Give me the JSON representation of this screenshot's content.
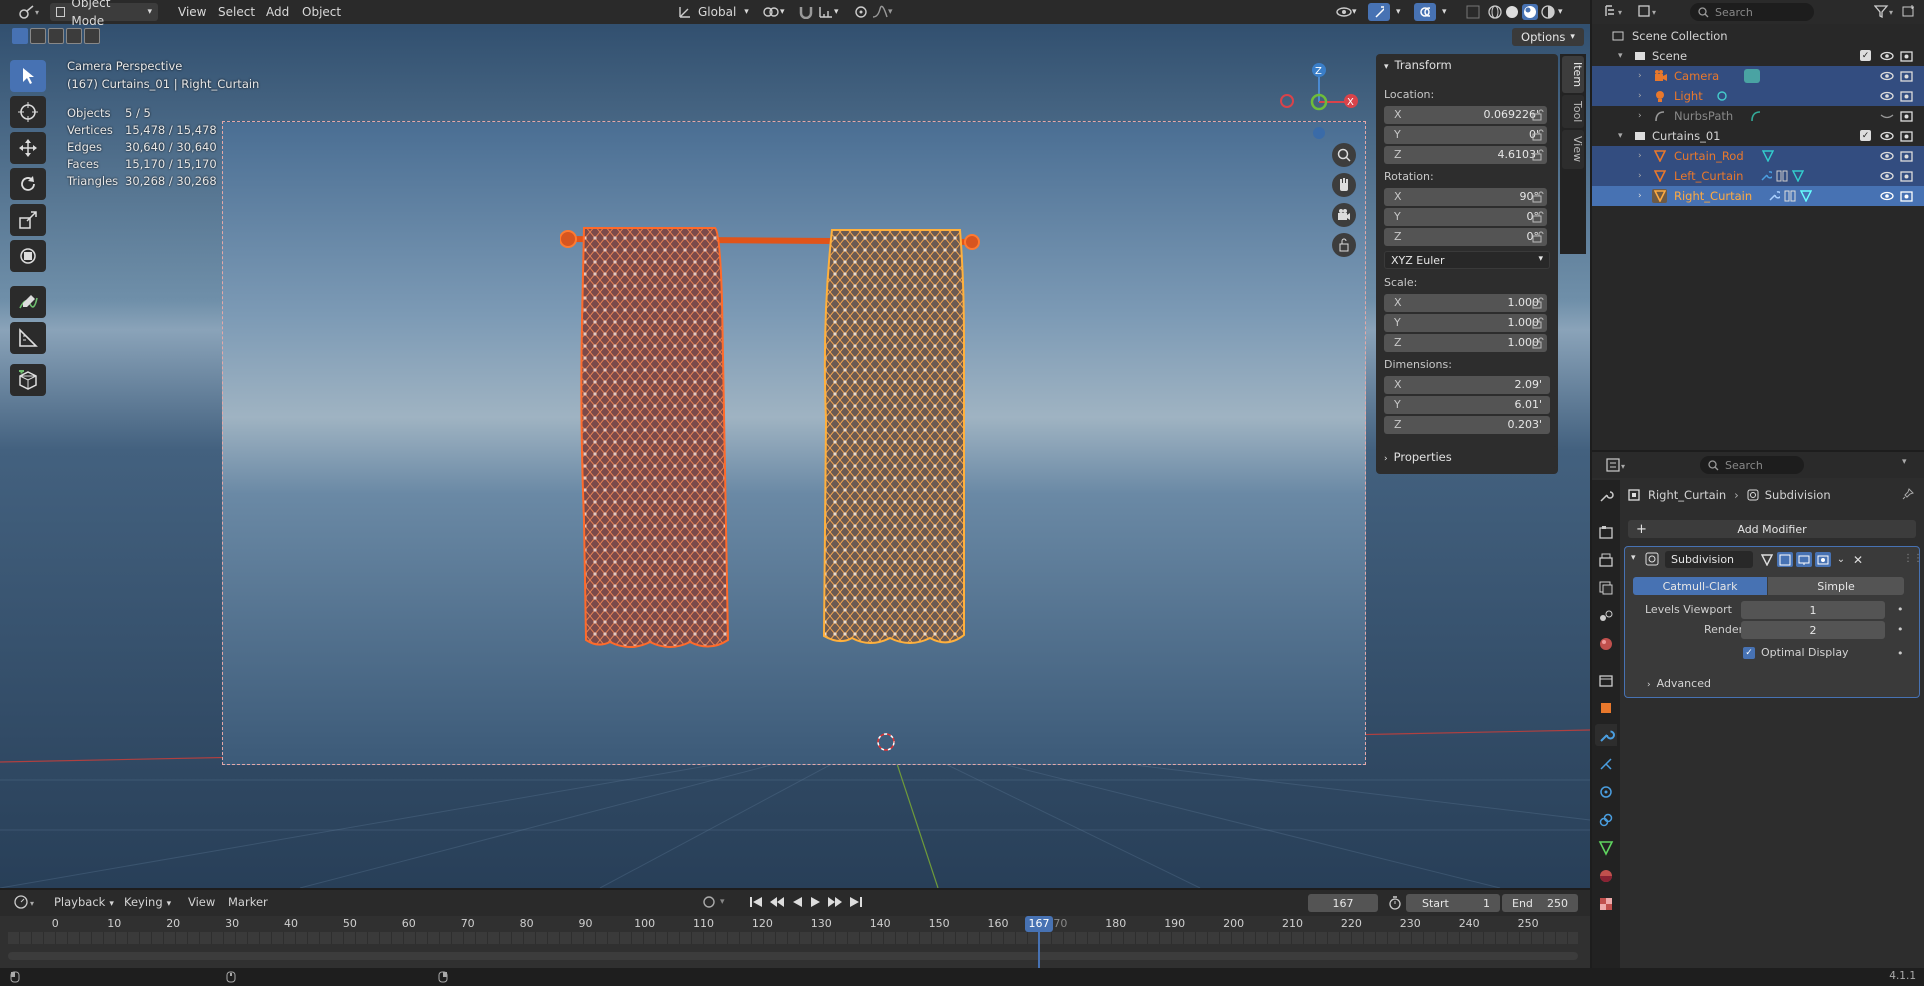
{
  "header": {
    "mode": "Object Mode",
    "menus": [
      "View",
      "Select",
      "Add",
      "Object"
    ],
    "transform_orientation": "Global",
    "options_label": "Options"
  },
  "overlay": {
    "camera_label": "Camera Perspective",
    "object_label": "(167) Curtains_01 | Right_Curtain",
    "stats": [
      {
        "label": "Objects",
        "value": "5 / 5"
      },
      {
        "label": "Vertices",
        "value": "15,478 / 15,478"
      },
      {
        "label": "Edges",
        "value": "30,640 / 30,640"
      },
      {
        "label": "Faces",
        "value": "15,170 / 15,170"
      },
      {
        "label": "Triangles",
        "value": "30,268 / 30,268"
      }
    ],
    "gizmo_z": "Z",
    "gizmo_x": "X"
  },
  "npanel": {
    "title": "Transform",
    "location_label": "Location:",
    "location": [
      {
        "axis": "X",
        "value": "0.069226'"
      },
      {
        "axis": "Y",
        "value": "0'"
      },
      {
        "axis": "Z",
        "value": "4.6103'"
      }
    ],
    "rotation_label": "Rotation:",
    "rotation": [
      {
        "axis": "X",
        "value": "90°"
      },
      {
        "axis": "Y",
        "value": "0°"
      },
      {
        "axis": "Z",
        "value": "0°"
      }
    ],
    "rotation_mode": "XYZ Euler",
    "scale_label": "Scale:",
    "scale": [
      {
        "axis": "X",
        "value": "1.000"
      },
      {
        "axis": "Y",
        "value": "1.000"
      },
      {
        "axis": "Z",
        "value": "1.000"
      }
    ],
    "dimensions_label": "Dimensions:",
    "dimensions": [
      {
        "axis": "X",
        "value": "2.09'"
      },
      {
        "axis": "Y",
        "value": "6.01'"
      },
      {
        "axis": "Z",
        "value": "0.203'"
      }
    ],
    "properties_label": "Properties",
    "tabs": [
      "Item",
      "Tool",
      "View"
    ]
  },
  "outliner": {
    "search_placeholder": "Search",
    "rows": [
      {
        "label": "Scene Collection",
        "indent": 0
      },
      {
        "label": "Scene",
        "indent": 1
      },
      {
        "label": "Camera",
        "indent": 2
      },
      {
        "label": "Light",
        "indent": 2
      },
      {
        "label": "NurbsPath",
        "indent": 2
      },
      {
        "label": "Curtains_01",
        "indent": 1
      },
      {
        "label": "Curtain_Rod",
        "indent": 2
      },
      {
        "label": "Left_Curtain",
        "indent": 2
      },
      {
        "label": "Right_Curtain",
        "indent": 2
      }
    ]
  },
  "properties": {
    "search_placeholder": "Search",
    "breadcrumb_object": "Right_Curtain",
    "breadcrumb_modifier": "Subdivision",
    "add_modifier": "Add Modifier",
    "modifier_name": "Subdivision",
    "method_a": "Catmull-Clark",
    "method_b": "Simple",
    "levels_viewport_label": "Levels Viewport",
    "levels_viewport": "1",
    "render_label": "Render",
    "render": "2",
    "optimal_display": "Optimal Display",
    "advanced": "Advanced"
  },
  "timeline": {
    "menus": [
      "Playback",
      "Keying",
      "View",
      "Marker"
    ],
    "current_frame": "167",
    "start_label": "Start",
    "start": "1",
    "end_label": "End",
    "end": "250",
    "ticks": [
      "0",
      "10",
      "20",
      "30",
      "40",
      "50",
      "60",
      "70",
      "80",
      "90",
      "100",
      "110",
      "120",
      "130",
      "140",
      "150",
      "160",
      "170",
      "180",
      "190",
      "200",
      "210",
      "220",
      "230",
      "240",
      "250"
    ],
    "playhead": "167"
  },
  "status": {
    "version": "4.1.1"
  },
  "colors": {
    "accent": "#4772b3",
    "selected_orange": "#e8782c",
    "active_orange": "#ffaa40"
  }
}
